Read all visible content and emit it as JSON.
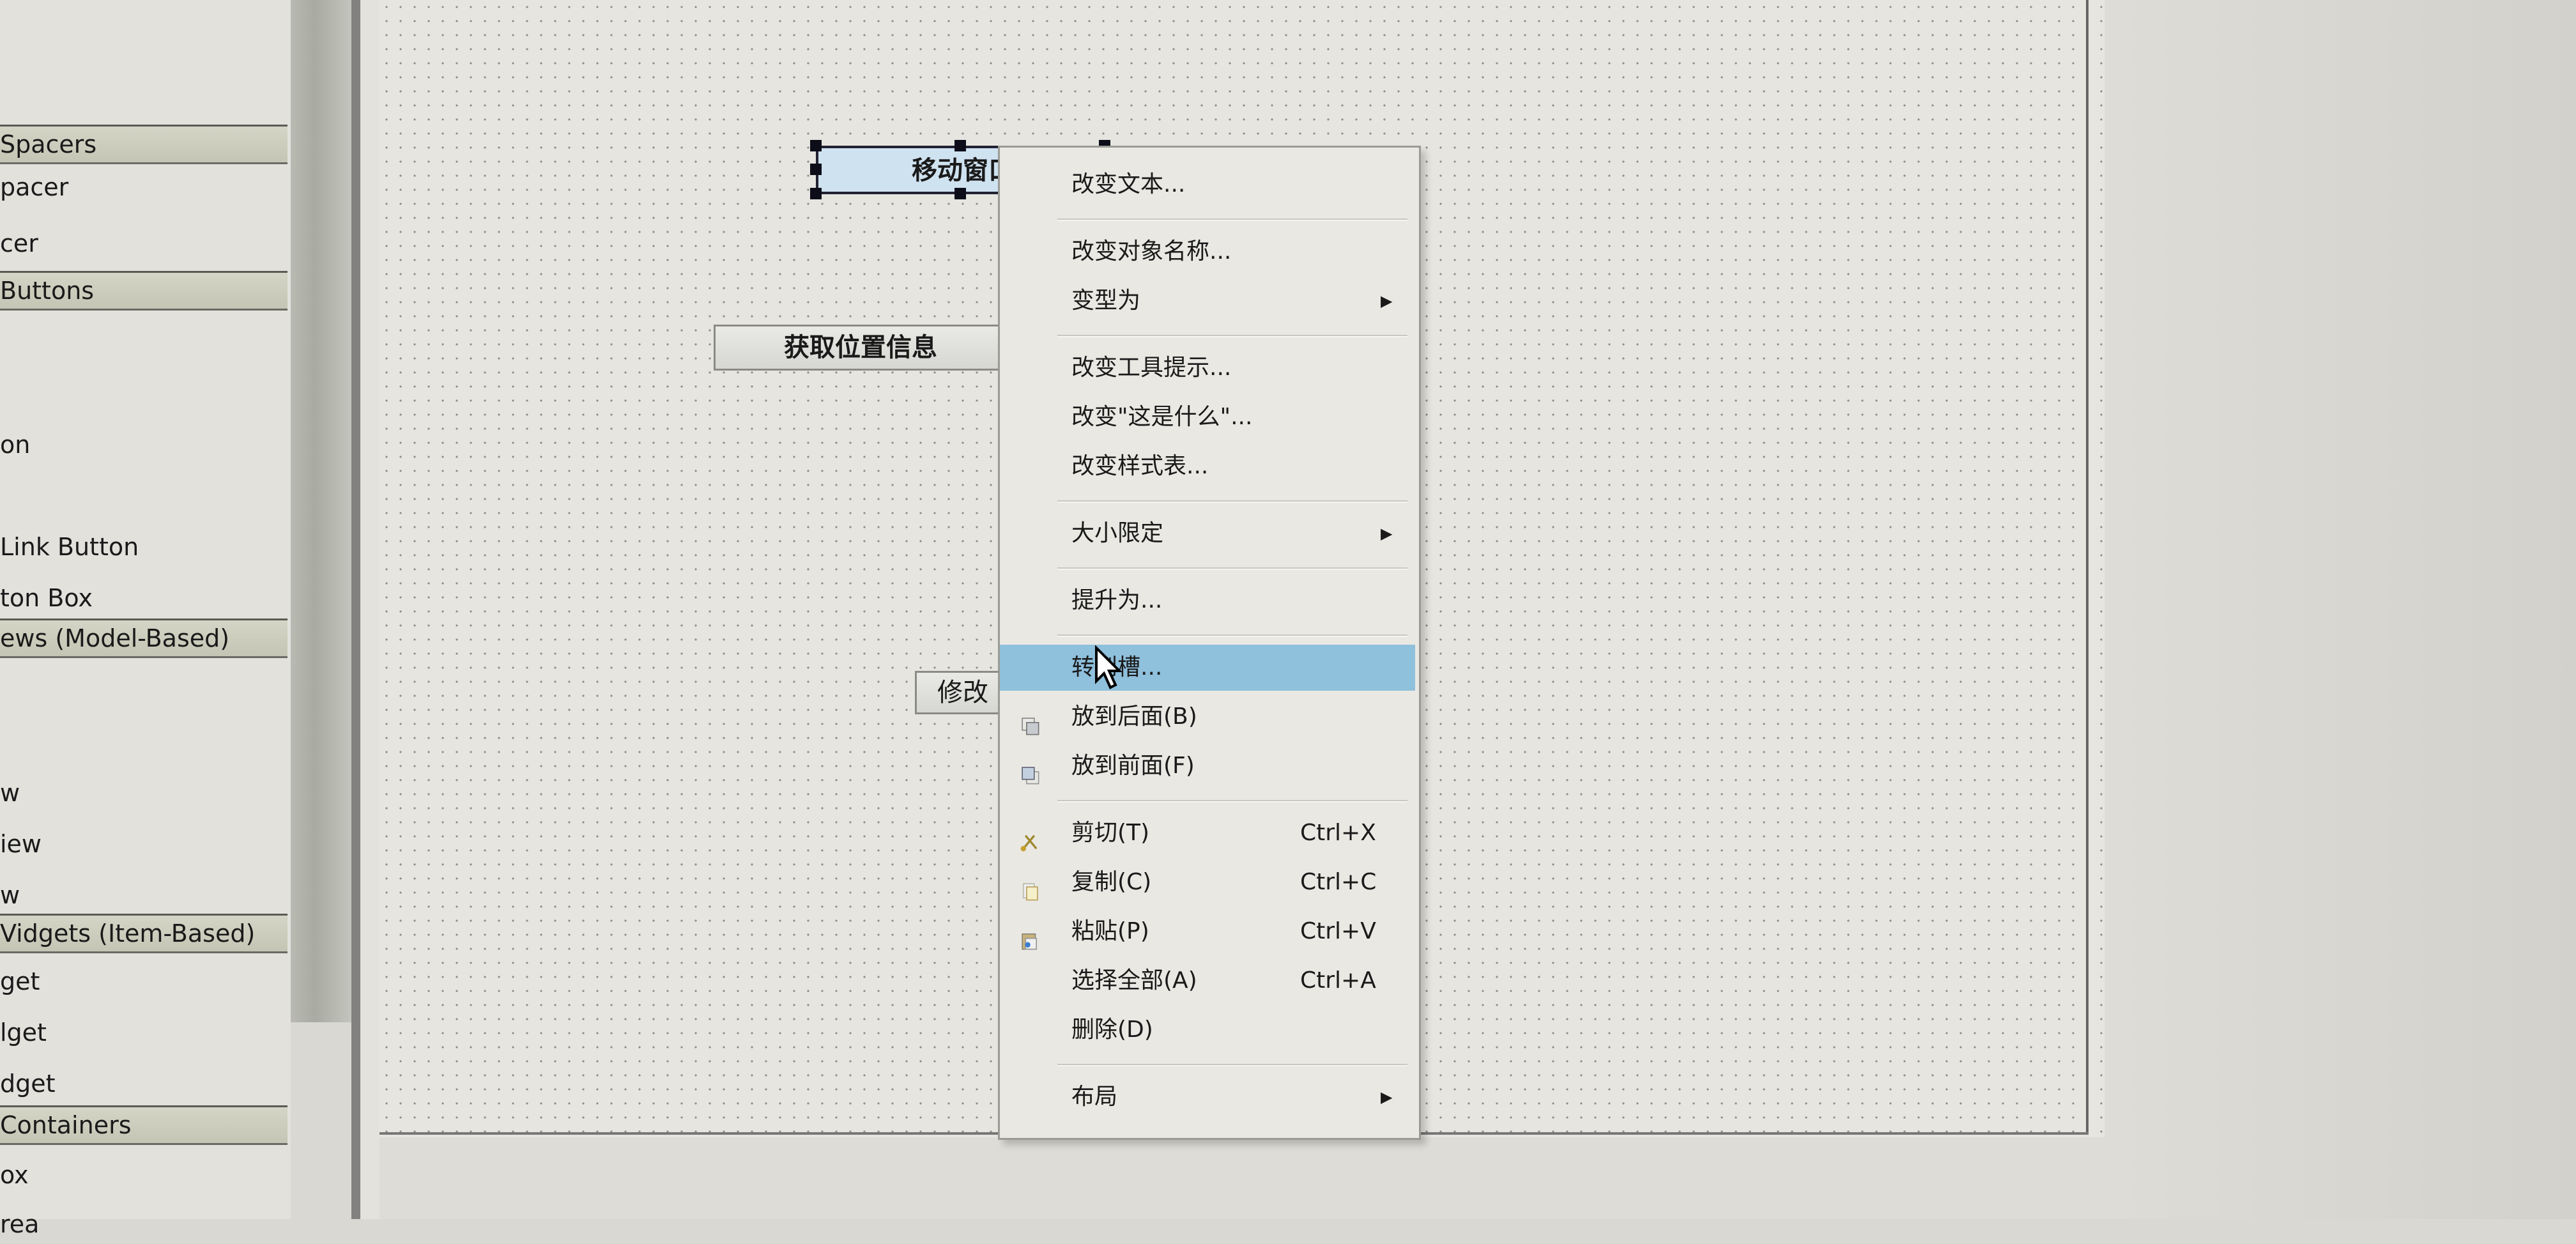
{
  "widget_box": {
    "entries": [
      {
        "type": "category",
        "label": "Spacers"
      },
      {
        "type": "item",
        "label": "pacer"
      },
      {
        "type": "item",
        "label": "cer"
      },
      {
        "type": "category",
        "label": " Buttons"
      },
      {
        "type": "item",
        "label": ""
      },
      {
        "type": "item",
        "label": ""
      },
      {
        "type": "item",
        "label": "on"
      },
      {
        "type": "item",
        "label": ""
      },
      {
        "type": "item",
        "label": " Link Button"
      },
      {
        "type": "item",
        "label": "ton Box"
      },
      {
        "type": "category",
        "label": "ews (Model-Based)"
      },
      {
        "type": "item",
        "label": ""
      },
      {
        "type": "item",
        "label": ""
      },
      {
        "type": "item",
        "label": "w"
      },
      {
        "type": "item",
        "label": "iew"
      },
      {
        "type": "item",
        "label": "w"
      },
      {
        "type": "category",
        "label": "Vidgets (Item-Based)"
      },
      {
        "type": "item",
        "label": "get"
      },
      {
        "type": "item",
        "label": "lget"
      },
      {
        "type": "item",
        "label": "dget"
      },
      {
        "type": "category",
        "label": "    Containers"
      },
      {
        "type": "item",
        "label": "ox"
      },
      {
        "type": "item",
        "label": "rea"
      }
    ]
  },
  "form": {
    "buttons": [
      {
        "id": "move",
        "label": "移动窗口",
        "selected": true
      },
      {
        "id": "getpos",
        "label": "获取位置信息",
        "selected": false
      },
      {
        "id": "modify",
        "label": "修改",
        "selected": false
      }
    ]
  },
  "context_menu": {
    "items": [
      {
        "label": "改变文本...",
        "shortcut": "",
        "submenu": false,
        "icon": ""
      },
      {
        "sep": true
      },
      {
        "label": "改变对象名称...",
        "shortcut": "",
        "submenu": false,
        "icon": ""
      },
      {
        "label": "变型为",
        "shortcut": "",
        "submenu": true,
        "icon": ""
      },
      {
        "sep": true
      },
      {
        "label": "改变工具提示...",
        "shortcut": "",
        "submenu": false,
        "icon": ""
      },
      {
        "label": "改变\"这是什么\"...",
        "shortcut": "",
        "submenu": false,
        "icon": ""
      },
      {
        "label": "改变样式表...",
        "shortcut": "",
        "submenu": false,
        "icon": ""
      },
      {
        "sep": true
      },
      {
        "label": "大小限定",
        "shortcut": "",
        "submenu": true,
        "icon": ""
      },
      {
        "sep": true
      },
      {
        "label": "提升为...",
        "shortcut": "",
        "submenu": false,
        "icon": ""
      },
      {
        "sep": true
      },
      {
        "label": "转到槽...",
        "shortcut": "",
        "submenu": false,
        "icon": "",
        "highlighted": true
      },
      {
        "label": "放到后面(B)",
        "shortcut": "",
        "submenu": false,
        "icon": "send-to-back-icon"
      },
      {
        "label": "放到前面(F)",
        "shortcut": "",
        "submenu": false,
        "icon": "bring-to-front-icon"
      },
      {
        "sep": true
      },
      {
        "label": "剪切(T)",
        "shortcut": "Ctrl+X",
        "submenu": false,
        "icon": "cut-icon"
      },
      {
        "label": "复制(C)",
        "shortcut": "Ctrl+C",
        "submenu": false,
        "icon": "copy-icon"
      },
      {
        "label": "粘贴(P)",
        "shortcut": "Ctrl+V",
        "submenu": false,
        "icon": "paste-icon"
      },
      {
        "label": "选择全部(A)",
        "shortcut": "Ctrl+A",
        "submenu": false,
        "icon": ""
      },
      {
        "label": "删除(D)",
        "shortcut": "",
        "submenu": false,
        "icon": ""
      },
      {
        "sep": true
      },
      {
        "label": "布局",
        "shortcut": "",
        "submenu": true,
        "icon": ""
      }
    ],
    "submenu_arrow": "▶",
    "highlight_color": "#8fc0dc"
  }
}
